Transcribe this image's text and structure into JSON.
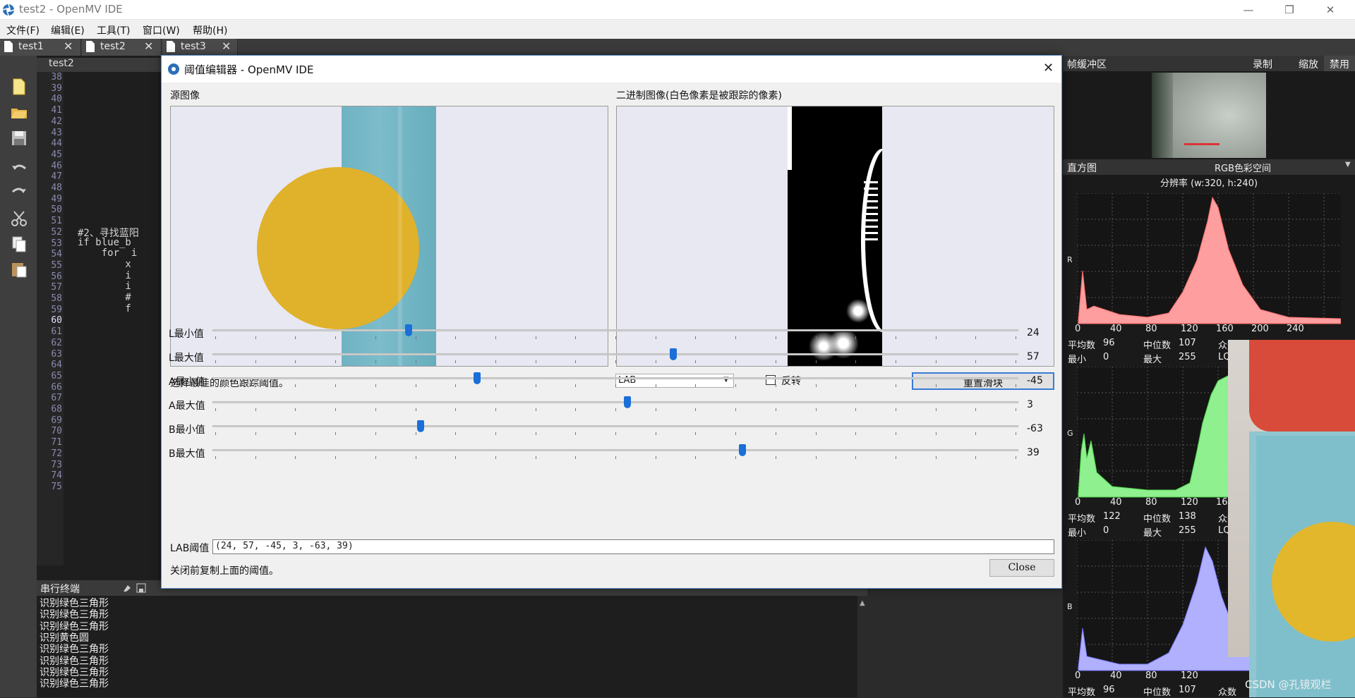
{
  "window": {
    "title": "test2 - OpenMV IDE",
    "min": "—",
    "restore": "❐",
    "close": "✕"
  },
  "menu": [
    "文件(F)",
    "编辑(E)",
    "工具(T)",
    "窗口(W)",
    "帮助(H)"
  ],
  "tabs": [
    {
      "label": "test1",
      "close": "✕"
    },
    {
      "label": "test2",
      "close": "✕"
    },
    {
      "label": "test3",
      "close": "✕"
    }
  ],
  "editor": {
    "filename": "test2",
    "line_numbers": [
      "38",
      "39",
      "40",
      "41",
      "42",
      "43",
      "44",
      "45",
      "46",
      "47",
      "48",
      "49",
      "50",
      "51",
      "52",
      "53",
      "54",
      "55",
      "56",
      "57",
      "58",
      "59",
      "60",
      "61",
      "62",
      "63",
      "64",
      "65",
      "66",
      "67",
      "68",
      "69",
      "70",
      "71",
      "72",
      "73",
      "74",
      "75"
    ],
    "current_line": "60",
    "code": [
      {
        "line": "52",
        "text": "#2、寻找蓝阳"
      },
      {
        "line": "53",
        "text": "if blue_b"
      },
      {
        "line": "54",
        "text": "    for  i"
      },
      {
        "line": "55",
        "text": "        x"
      },
      {
        "line": "56",
        "text": "        i"
      },
      {
        "line": "57",
        "text": "        i"
      },
      {
        "line": "58",
        "text": "        #"
      },
      {
        "line": "59",
        "text": "        f"
      }
    ]
  },
  "serial": {
    "title": "串行终端",
    "lines": [
      "识别绿色三角形",
      "识别绿色三角形",
      "识别绿色三角形",
      "识别黄色圆",
      "识别绿色三角形",
      "识别绿色三角形",
      "识别绿色三角形",
      "识别绿色三角形"
    ]
  },
  "framebuffer": {
    "title": "帧缓冲区",
    "record": "录制",
    "zoom": "缩放",
    "disable": "禁用"
  },
  "histogram": {
    "title": "直方图",
    "colorspace": "RGB色彩空间",
    "resolution": "分辨率 (w:320, h:240)",
    "x_ticks": [
      "0",
      "40",
      "80",
      "120",
      "160",
      "200",
      "240"
    ],
    "channels": [
      {
        "name": "R",
        "color": "#ff9e9e",
        "mean_label": "平均数",
        "mean": "96",
        "median_label": "中位数",
        "median": "107",
        "mode_label": "众数",
        "min_label": "最小",
        "min": "0",
        "max_label": "最大",
        "max": "255",
        "lq_label": "LQ"
      },
      {
        "name": "G",
        "color": "#8ef08e",
        "mean_label": "平均数",
        "mean": "122",
        "median_label": "中位数",
        "median": "138",
        "mode_label": "众数",
        "min_label": "最小",
        "min": "0",
        "max_label": "最大",
        "max": "255",
        "lq_label": "LQ"
      },
      {
        "name": "B",
        "color": "#b0b0ff",
        "mean_label": "平均数",
        "mean": "96",
        "median_label": "中位数",
        "median": "107",
        "mode_label": "众数"
      }
    ]
  },
  "watermark": "CSDN @孔镜观栏",
  "dialog": {
    "title": "阈值编辑器 - OpenMV IDE",
    "close": "✕",
    "source_label": "源图像",
    "binary_label": "二进制图像(白色像素是被跟踪的像素)",
    "instruction": "选择最佳的颜色跟踪阈值。",
    "colorspace": "LAB",
    "invert_label": "反转",
    "reset_button": "重置滑块",
    "sliders": [
      {
        "label": "L最小值",
        "value": "24",
        "pos": 0.243
      },
      {
        "label": "L最大值",
        "value": "57",
        "pos": 0.572
      },
      {
        "label": "A最小值",
        "value": "-45",
        "pos": 0.328
      },
      {
        "label": "A最大值",
        "value": "3",
        "pos": 0.515
      },
      {
        "label": "B最小值",
        "value": "-63",
        "pos": 0.258
      },
      {
        "label": "B最大值",
        "value": "39",
        "pos": 0.658
      }
    ],
    "threshold_label": "LAB阈值",
    "threshold_value": "(24, 57, -45, 3, -63, 39)",
    "footer_note": "关闭前复制上面的阈值。",
    "close_button": "Close"
  }
}
